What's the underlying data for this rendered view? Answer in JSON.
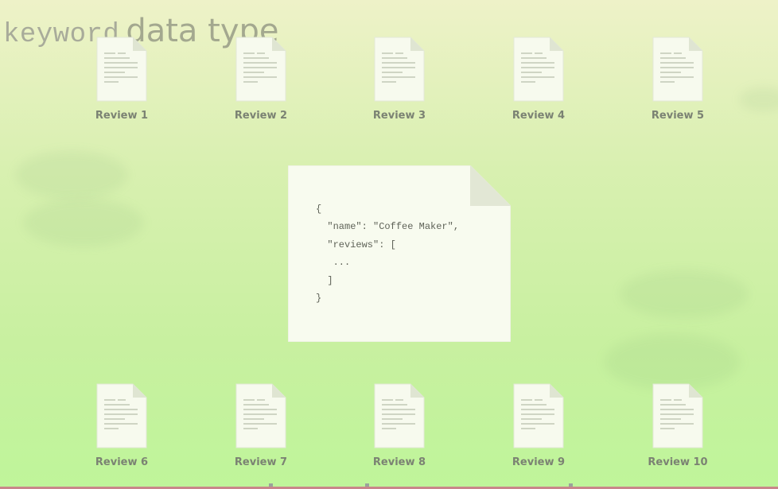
{
  "title": {
    "keyword": "keyword",
    "rest": "data type"
  },
  "documents_top": [
    {
      "label": "Review 1"
    },
    {
      "label": "Review 2"
    },
    {
      "label": "Review 3"
    },
    {
      "label": "Review 4"
    },
    {
      "label": "Review 5"
    }
  ],
  "documents_bottom": [
    {
      "label": "Review 6"
    },
    {
      "label": "Review 7"
    },
    {
      "label": "Review 8"
    },
    {
      "label": "Review 9"
    },
    {
      "label": "Review 10"
    }
  ],
  "json_card": {
    "lines": [
      "{",
      "  \"name\": \"Coffee Maker\",",
      "  \"reviews\": [",
      "   ...",
      "  ]",
      "}"
    ]
  },
  "icons": {
    "document": "document-icon",
    "json_card": "json-document-icon"
  }
}
